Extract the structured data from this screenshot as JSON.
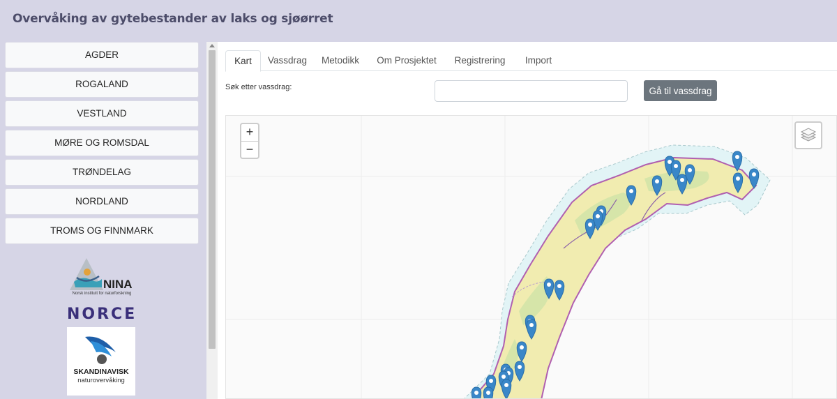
{
  "header": {
    "title": "Overvåking av gytebestander av laks og sjøørret"
  },
  "sidebar": {
    "regions": [
      {
        "label": "AGDER"
      },
      {
        "label": "ROGALAND"
      },
      {
        "label": "VESTLAND"
      },
      {
        "label": "MØRE OG ROMSDAL"
      },
      {
        "label": "TRØNDELAG"
      },
      {
        "label": "NORDLAND"
      },
      {
        "label": "TROMS OG FINNMARK"
      }
    ],
    "logos": {
      "nina_name": "NINA",
      "nina_sub": "Norsk institutt for naturforskning",
      "norce": "NORCE",
      "skand_line1": "SKANDINAVISK",
      "skand_line2": "naturovervåking"
    }
  },
  "tabs": [
    {
      "label": "Kart",
      "active": true
    },
    {
      "label": "Vassdrag"
    },
    {
      "label": "Metodikk"
    },
    {
      "label": "Om Prosjektet"
    },
    {
      "label": "Registrering"
    },
    {
      "label": "Import"
    }
  ],
  "search": {
    "label": "Søk etter vassdrag:",
    "value": "",
    "placeholder": "",
    "button_label": "Gå til vassdrag"
  },
  "map": {
    "zoom_in": "+",
    "zoom_out": "−",
    "marker_color": "#3a87c8",
    "land_color": "#f1ecb0",
    "sea_color": "#e2f4f6",
    "border_color": "#b05fb0"
  },
  "colors": {
    "background": "#d6d5e6",
    "title": "#4d4d6a",
    "button": "#6c757d"
  }
}
